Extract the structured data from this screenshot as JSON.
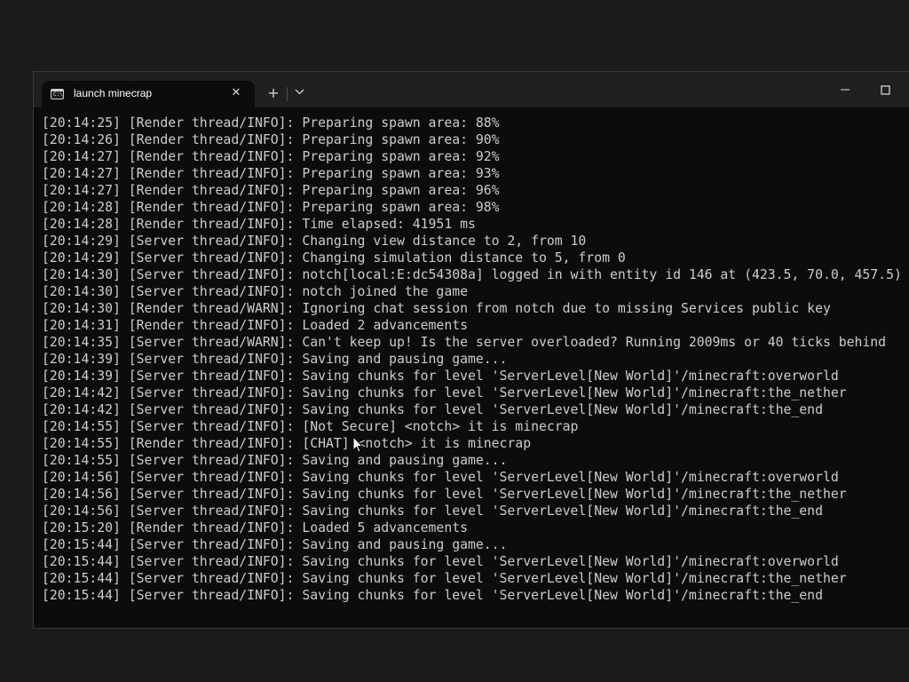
{
  "window": {
    "tab_title": "launch minecrap",
    "tab_close": "✕",
    "new_tab": "+"
  },
  "icons": {
    "tab": "terminal-icon",
    "close": "close-icon",
    "new_tab": "plus-icon",
    "dropdown": "chevron-down-icon",
    "minimize": "minimize-icon",
    "maximize": "maximize-icon",
    "cursor": "mouse-pointer-icon"
  },
  "terminal": {
    "lines": [
      "[20:14:25] [Render thread/INFO]: Preparing spawn area: 88%",
      "[20:14:26] [Render thread/INFO]: Preparing spawn area: 90%",
      "[20:14:27] [Render thread/INFO]: Preparing spawn area: 92%",
      "[20:14:27] [Render thread/INFO]: Preparing spawn area: 93%",
      "[20:14:27] [Render thread/INFO]: Preparing spawn area: 96%",
      "[20:14:28] [Render thread/INFO]: Preparing spawn area: 98%",
      "[20:14:28] [Render thread/INFO]: Time elapsed: 41951 ms",
      "[20:14:29] [Server thread/INFO]: Changing view distance to 2, from 10",
      "[20:14:29] [Server thread/INFO]: Changing simulation distance to 5, from 0",
      "[20:14:30] [Server thread/INFO]: notch[local:E:dc54308a] logged in with entity id 146 at (423.5, 70.0, 457.5)",
      "[20:14:30] [Server thread/INFO]: notch joined the game",
      "[20:14:30] [Render thread/WARN]: Ignoring chat session from notch due to missing Services public key",
      "[20:14:31] [Render thread/INFO]: Loaded 2 advancements",
      "[20:14:35] [Server thread/WARN]: Can't keep up! Is the server overloaded? Running 2009ms or 40 ticks behind",
      "[20:14:39] [Server thread/INFO]: Saving and pausing game...",
      "[20:14:39] [Server thread/INFO]: Saving chunks for level 'ServerLevel[New World]'/minecraft:overworld",
      "[20:14:42] [Server thread/INFO]: Saving chunks for level 'ServerLevel[New World]'/minecraft:the_nether",
      "[20:14:42] [Server thread/INFO]: Saving chunks for level 'ServerLevel[New World]'/minecraft:the_end",
      "[20:14:55] [Server thread/INFO]: [Not Secure] <notch> it is minecrap",
      "[20:14:55] [Render thread/INFO]: [CHAT] <notch> it is minecrap",
      "[20:14:55] [Server thread/INFO]: Saving and pausing game...",
      "[20:14:56] [Server thread/INFO]: Saving chunks for level 'ServerLevel[New World]'/minecraft:overworld",
      "[20:14:56] [Server thread/INFO]: Saving chunks for level 'ServerLevel[New World]'/minecraft:the_nether",
      "[20:14:56] [Server thread/INFO]: Saving chunks for level 'ServerLevel[New World]'/minecraft:the_end",
      "[20:15:20] [Render thread/INFO]: Loaded 5 advancements",
      "[20:15:44] [Server thread/INFO]: Saving and pausing game...",
      "[20:15:44] [Server thread/INFO]: Saving chunks for level 'ServerLevel[New World]'/minecraft:overworld",
      "[20:15:44] [Server thread/INFO]: Saving chunks for level 'ServerLevel[New World]'/minecraft:the_nether",
      "[20:15:44] [Server thread/INFO]: Saving chunks for level 'ServerLevel[New World]'/minecraft:the_end"
    ]
  },
  "colors": {
    "terminal_bg": "#0c0c0c",
    "terminal_text": "#cccccc",
    "titlebar_bg": "#202020",
    "desktop_bg": "#1b1b1b"
  }
}
